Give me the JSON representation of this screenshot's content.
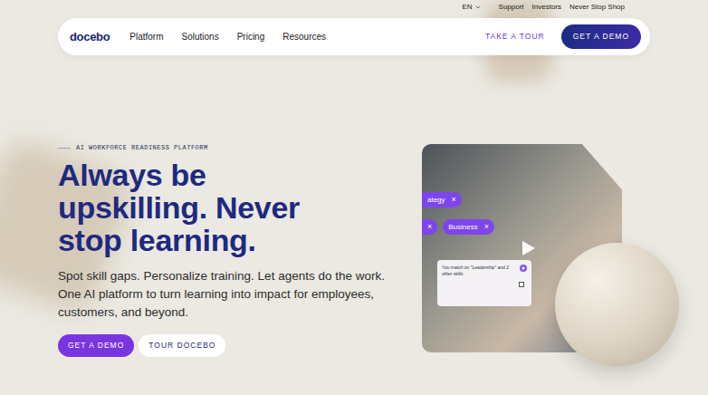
{
  "utility_bar": {
    "language": "EN",
    "links": [
      "Support",
      "Investors",
      "Never Stop Shop"
    ]
  },
  "nav": {
    "logo": "docebo",
    "items": [
      "Platform",
      "Solutions",
      "Pricing",
      "Resources"
    ],
    "tour_link": "TAKE A TOUR",
    "demo_button": "GET A DEMO"
  },
  "hero": {
    "eyebrow": "AI WORKFORCE READINESS PLATFORM",
    "headline_lines": [
      "Always be",
      "upskilling. Never",
      "stop learning."
    ],
    "body_lines": [
      "Spot skill gaps. Personalize training. Let agents do the work.",
      "One AI platform to turn learning into impact for employees,",
      "customers, and beyond."
    ],
    "buttons": [
      {
        "label": "GET A DEMO",
        "kind": "primary"
      },
      {
        "label": "TOUR DOCEBO",
        "kind": "secondary"
      }
    ]
  },
  "media": {
    "chip_rows": [
      [
        {
          "label": "ategy",
          "close": "×",
          "cut_left": true
        }
      ],
      [
        {
          "label": "",
          "close": "×",
          "cut_left": true
        },
        {
          "label": "Business",
          "close": "×",
          "cut_left": false
        }
      ]
    ],
    "match_card": {
      "text": "You match on \"Leadership\" and 2 other skills"
    }
  }
}
